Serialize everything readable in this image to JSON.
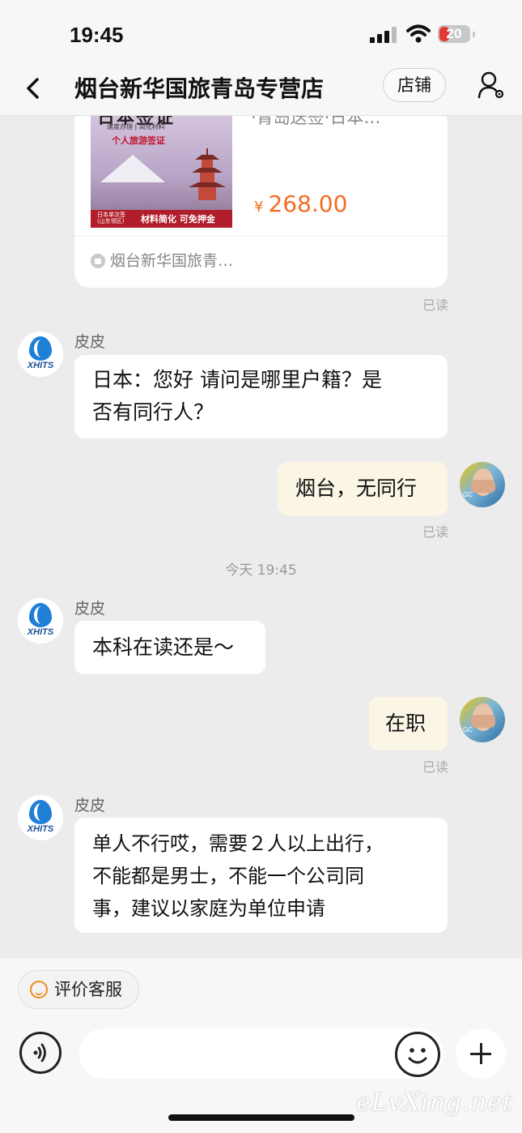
{
  "status_bar": {
    "time": "19:45",
    "battery": "20",
    "battery_level": 0.2
  },
  "nav": {
    "title": "烟台新华国旅青岛专营店",
    "shop_button": "店铺"
  },
  "product_card": {
    "image_title": "日本签证",
    "image_subtitle": "速度办理 | 简化材料",
    "image_tagline": "个人旅游签证",
    "image_banner_small": "日本单次签",
    "image_banner_region": "(山东领区)",
    "image_banner_main": "材料简化  可免押金",
    "description": "·青岛送签·日本…",
    "currency": "¥",
    "price": "268.00",
    "shop_name": "烟台新华国旅青…"
  },
  "messages": [
    {
      "side": "left",
      "sender": "皮皮",
      "avatar_text": "XHITS",
      "lines": [
        "日本：您好 请问是哪里户籍？是",
        "否有同行人？"
      ]
    },
    {
      "side": "right",
      "lines": [
        "烟台，无同行"
      ],
      "status": "已读",
      "avatar_caption": "GC"
    },
    {
      "side": "center",
      "time": "今天 19:45"
    },
    {
      "side": "left",
      "sender": "皮皮",
      "avatar_text": "XHITS",
      "lines": [
        "本科在读还是～"
      ]
    },
    {
      "side": "right",
      "lines": [
        "在职"
      ],
      "status": "已读",
      "avatar_caption": "GC"
    },
    {
      "side": "left",
      "sender": "皮皮",
      "avatar_text": "XHITS",
      "lines": [
        "单人不行哎，需要２人以上出行，",
        "不能都是男士，不能一个公司同",
        "事，建议以家庭为单位申请"
      ]
    }
  ],
  "read_status_card": "已读",
  "bottom": {
    "rate_label": "评价客服",
    "input_value": "",
    "watermark": "eLvXing.net"
  },
  "colors": {
    "price": "#f36d21",
    "my_bubble": "#fbf5e6",
    "chat_bg": "#ececec"
  }
}
